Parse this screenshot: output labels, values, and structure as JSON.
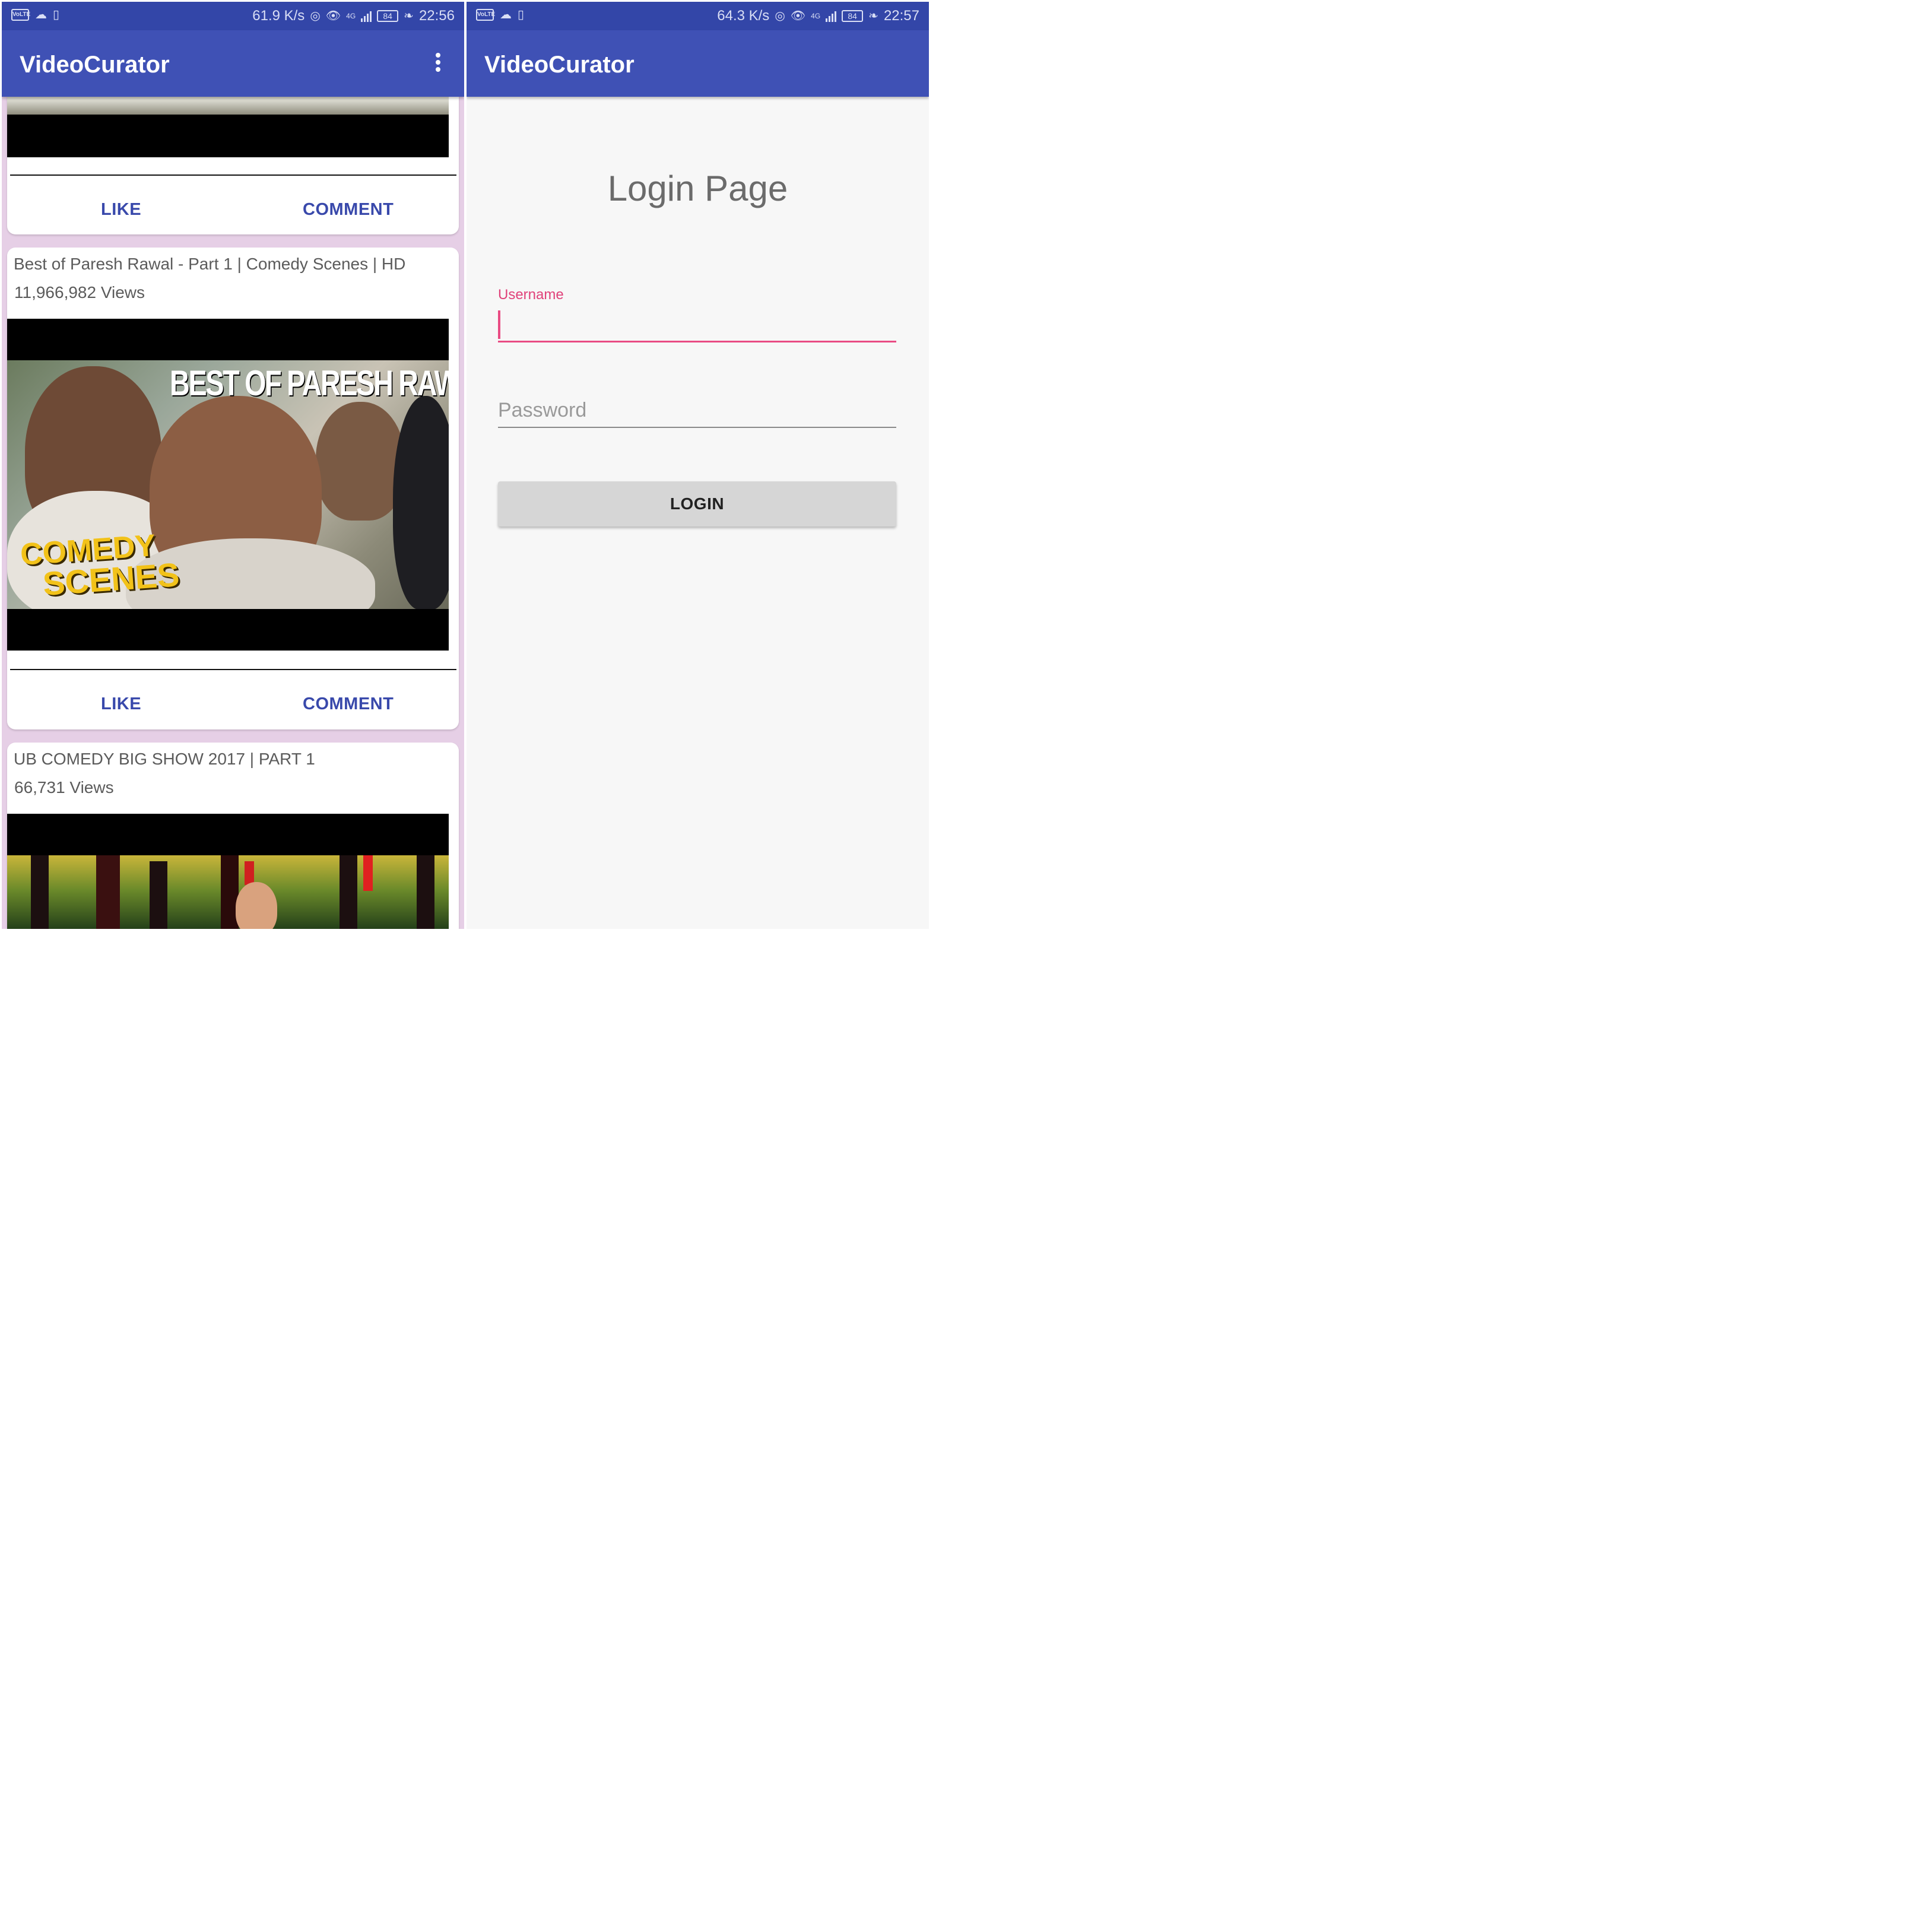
{
  "left_screen": {
    "status": {
      "speed": "61.9 K/s",
      "battery": "84",
      "time": "22:56",
      "volte": "VoLTE",
      "network": "4G",
      "icons": [
        "cloud-icon",
        "battery-charging-icon",
        "hotspot-icon",
        "eye-icon",
        "signal-icon",
        "leaf-icon"
      ]
    },
    "app_title": "VideoCurator",
    "overflow_icon": "overflow-menu-icon",
    "cards": [
      {
        "like": "LIKE",
        "comment": "COMMENT"
      },
      {
        "title": "Best of Paresh Rawal - Part 1 | Comedy Scenes | HD",
        "views": "11,966,982 Views",
        "thumb_caption": "BEST OF PARESH RAWAL",
        "thumb_tag_1": "COMEDY",
        "thumb_tag_2": "SCENES",
        "like": "LIKE",
        "comment": "COMMENT"
      },
      {
        "title": "UB COMEDY BIG SHOW 2017 | PART 1",
        "views": "66,731 Views"
      }
    ]
  },
  "right_screen": {
    "status": {
      "speed": "64.3 K/s",
      "battery": "84",
      "time": "22:57",
      "volte": "VoLTE",
      "network": "4G"
    },
    "app_title": "VideoCurator",
    "heading": "Login Page",
    "username_label": "Username",
    "username_value": "",
    "password_placeholder": "Password",
    "login_button": "LOGIN"
  },
  "colors": {
    "primary": "#3f51b5",
    "status_bar": "#3346a8",
    "accent": "#e94b83",
    "link": "#3949ab",
    "feed_background": "#e6cfe6"
  }
}
